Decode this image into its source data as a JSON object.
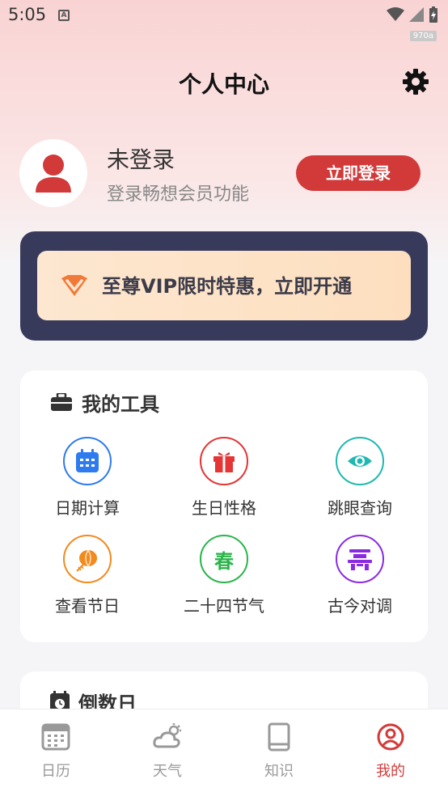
{
  "status_bar": {
    "time": "5:05",
    "tag": "970a"
  },
  "header": {
    "title": "个人中心"
  },
  "profile": {
    "name": "未登录",
    "subtitle": "登录畅想会员功能",
    "login_button": "立即登录"
  },
  "vip_banner": {
    "text": "至尊VIP限时特惠，立即开通"
  },
  "tools": {
    "title": "我的工具",
    "items": [
      {
        "label": "日期计算",
        "icon": "calendar-icon",
        "color": "#2e7bf0"
      },
      {
        "label": "生日性格",
        "icon": "gift-icon",
        "color": "#e53535"
      },
      {
        "label": "跳眼查询",
        "icon": "eye-icon",
        "color": "#20b8b0"
      },
      {
        "label": "查看节日",
        "icon": "lantern-icon",
        "color": "#f28a1e"
      },
      {
        "label": "二十四节气",
        "icon": "spring-icon",
        "color": "#2bb54a",
        "glyph": "春"
      },
      {
        "label": "古今对调",
        "icon": "pagoda-icon",
        "color": "#8a2be2"
      }
    ]
  },
  "countdown": {
    "title": "倒数日"
  },
  "bottom_nav": {
    "items": [
      {
        "label": "日历",
        "icon": "calendar-grid-icon"
      },
      {
        "label": "天气",
        "icon": "weather-icon"
      },
      {
        "label": "知识",
        "icon": "book-icon"
      },
      {
        "label": "我的",
        "icon": "user-circle-icon",
        "active": true
      }
    ]
  },
  "colors": {
    "accent": "#d23a3a",
    "vip_bg": "#383a5c",
    "vip_inner": "#fde2c6"
  }
}
